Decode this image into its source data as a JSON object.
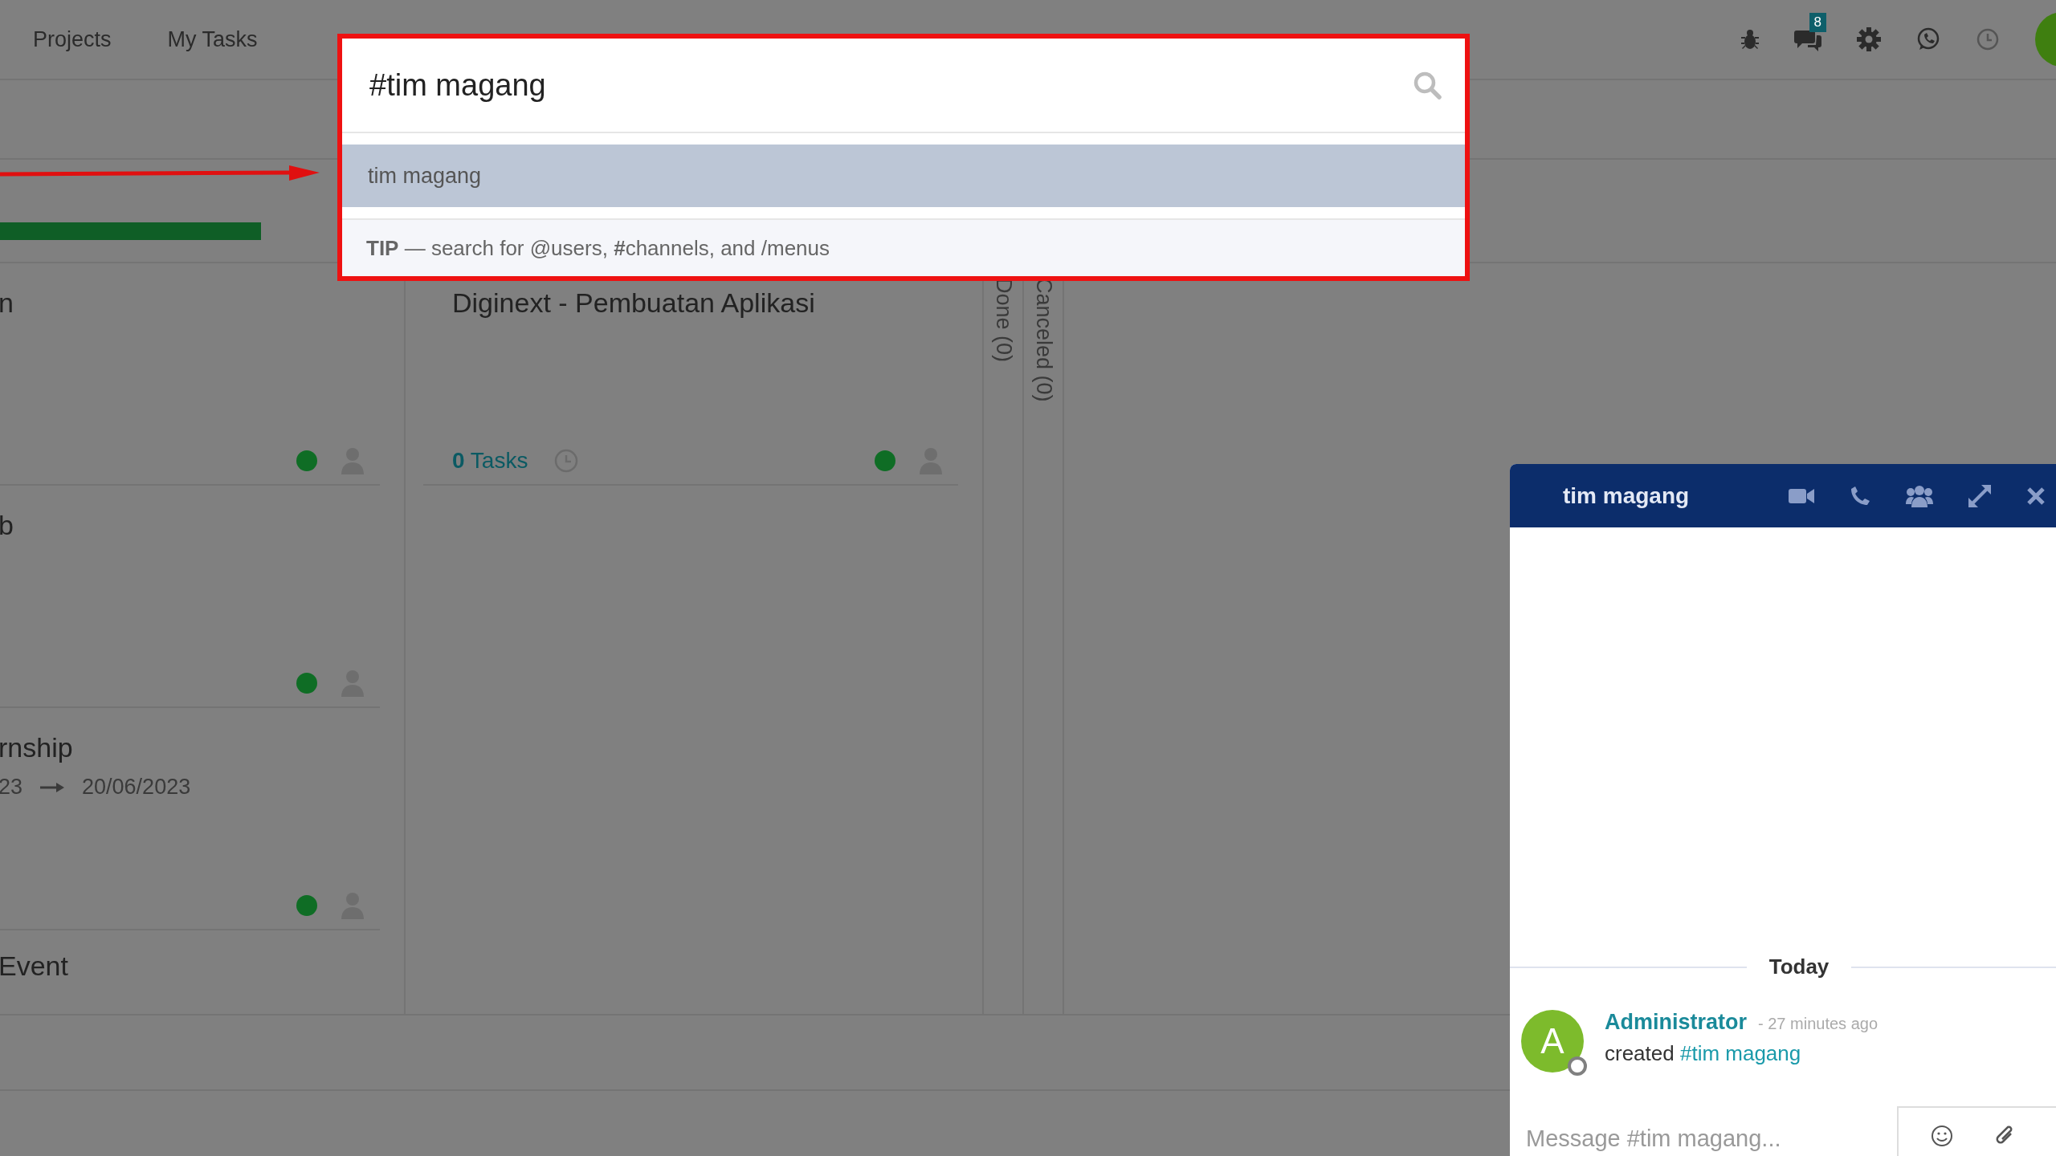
{
  "navbar": {
    "menu": [
      {
        "label": "Projects"
      },
      {
        "label": "My Tasks"
      }
    ],
    "chat_badge": "8"
  },
  "board": {
    "columns": [
      {
        "cards": [
          {
            "kind": "card",
            "title": "n"
          },
          {
            "kind": "card",
            "title": "b"
          },
          {
            "kind": "card",
            "title": "rnship",
            "date_start": "23",
            "date_end": "20/06/2023"
          },
          {
            "kind": "title_only",
            "title": "Event"
          }
        ]
      },
      {
        "cards": [
          {
            "kind": "card",
            "title": "Diginext - Pembuatan Aplikasi",
            "task_count": "0",
            "task_label": "Tasks"
          }
        ]
      }
    ],
    "folded_columns": [
      {
        "label": "Done (0)"
      },
      {
        "label": "Canceled (0)"
      }
    ]
  },
  "search": {
    "value": "#tim magang",
    "results": [
      {
        "label": "tim magang",
        "selected": true
      }
    ],
    "tip": "**TIP** — search for @users, **#**channels, and /menus"
  },
  "chat": {
    "title": "tim magang",
    "divider": "Today",
    "messages": [
      {
        "avatar": "A",
        "author": "Administrator",
        "time": "- 27 minutes ago",
        "text": "created",
        "link": "#tim magang"
      }
    ],
    "placeholder": "Message #tim magang..."
  }
}
